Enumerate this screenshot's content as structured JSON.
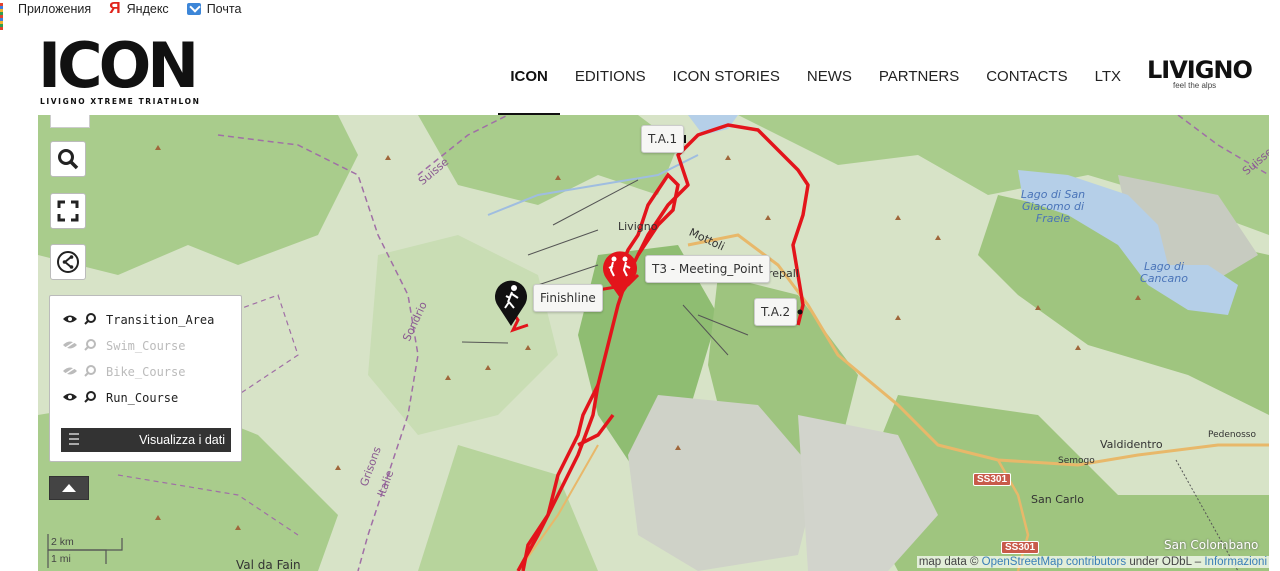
{
  "bookmarks": [
    {
      "label": "Приложения",
      "icon": "apps-grid-icon"
    },
    {
      "label": "Яндекс",
      "icon": "yandex-icon"
    },
    {
      "label": "Почта",
      "icon": "mail-icon"
    }
  ],
  "header": {
    "logo_text": "ICON",
    "logo_subtitle": "LIVIGNO XTREME TRIATHLON",
    "nav": [
      "ICON",
      "EDITIONS",
      "ICON STORIES",
      "NEWS",
      "PARTNERS",
      "CONTACTS",
      "LTX"
    ],
    "active_nav": "ICON",
    "partner_logo": "LIVIGNO",
    "partner_tagline": "feel the alps"
  },
  "map": {
    "controls": [
      "search-icon",
      "fullscreen-icon",
      "share-icon"
    ],
    "layers": [
      {
        "label": "Transition_Area",
        "visible": true
      },
      {
        "label": "Swim_Course",
        "visible": false
      },
      {
        "label": "Bike_Course",
        "visible": false
      },
      {
        "label": "Run_Course",
        "visible": true
      }
    ],
    "data_button": "Visualizza i dati",
    "markers": [
      "T.A.1",
      "T.A.2",
      "Finishline",
      "T3 - Meeting_Point"
    ],
    "places": {
      "livigno": "Livigno",
      "mottolino": "Mottoli",
      "trepalle": "repall",
      "trepalle2": "Trepalle",
      "suisse": "Suisse",
      "suisse2": "Suisse",
      "sondrio": "Sondrio",
      "grisons": "Grisons",
      "italia": "Italie",
      "valdidentro": "Valdidentro",
      "semogo": "Semogo",
      "san_carlo": "San Carlo",
      "pedenosso": "Pedenosso",
      "san_colombano": "San Colombano",
      "val_da_fain": "Val da Fain",
      "lake1": "Lago di San Giacomo di Fraele",
      "lake2": "Lago di Cancano",
      "road1": "SS301",
      "road2": "SS301"
    },
    "scale": {
      "km": "2 km",
      "mi": "1 mi"
    },
    "attribution": {
      "prefix": "map data ©",
      "osm": "OpenStreetMap contributors",
      "mid": "under ODbL –",
      "info": "Informazioni"
    },
    "colors": {
      "route": "#e3141b",
      "water": "#b5cfe8",
      "forest": "#9ec47f",
      "meadow": "#d2e2bf",
      "rock": "#cfcfc9"
    }
  }
}
